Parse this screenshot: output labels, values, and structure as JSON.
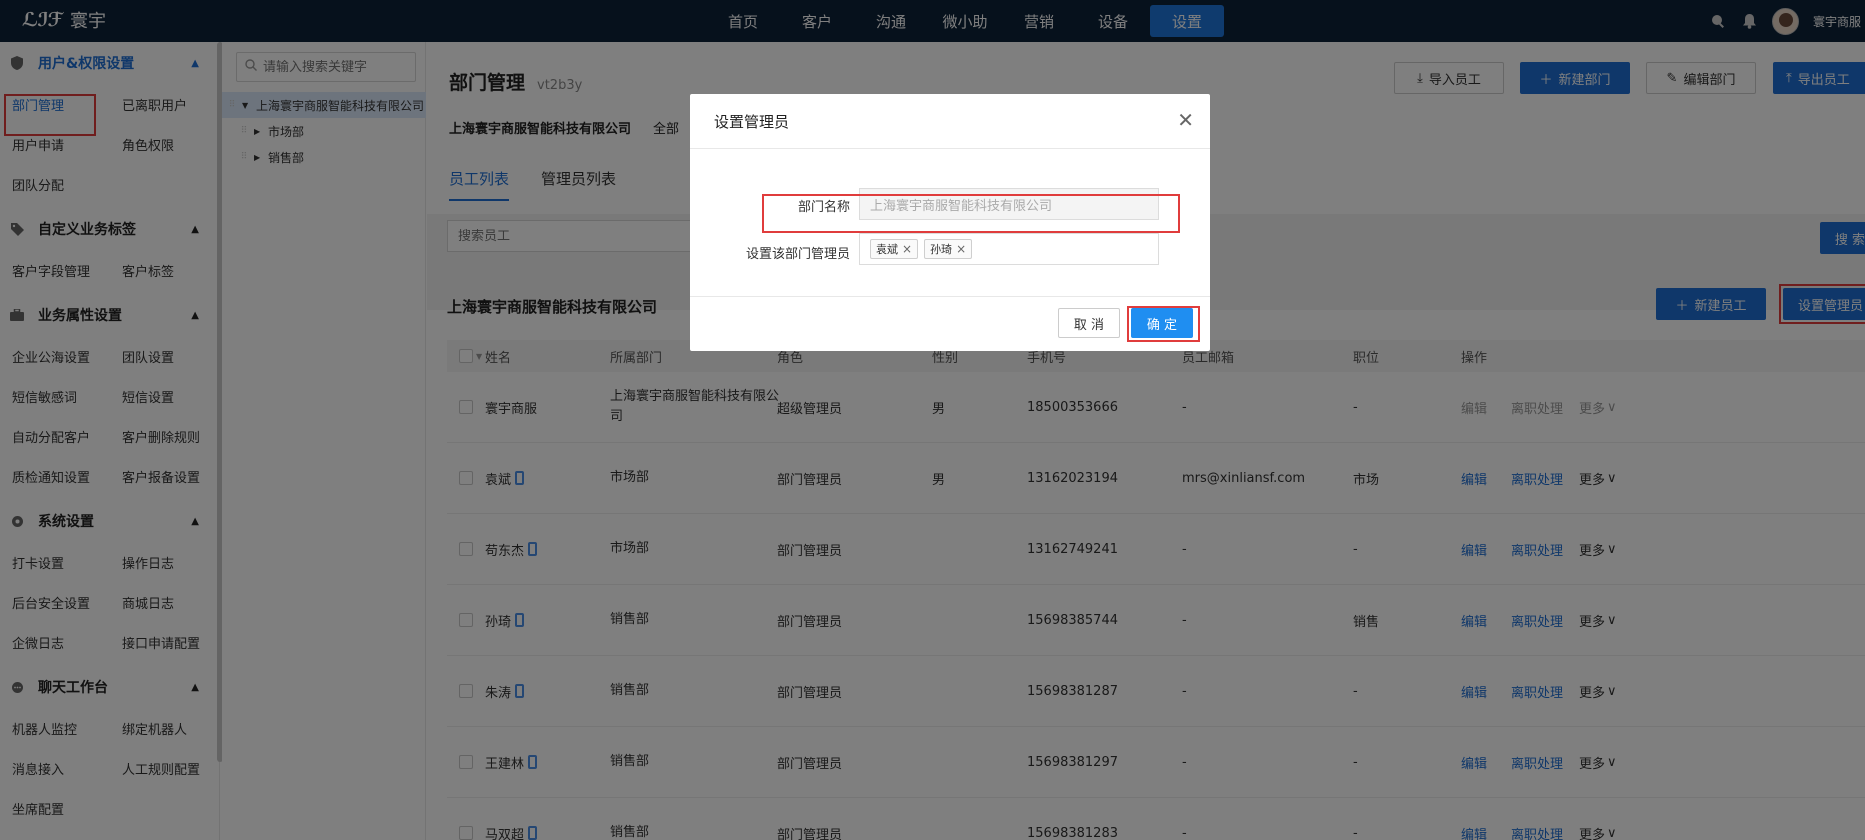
{
  "topbar": {
    "logo_mark": "ℒℐℱ",
    "logo_text": "寰宇",
    "nav": [
      "首页",
      "客户",
      "沟通",
      "微小助",
      "营销",
      "设备",
      "设置"
    ],
    "active_nav": "设置",
    "username": "寰宇商服"
  },
  "sidebar": {
    "sections": [
      {
        "title": "用户&权限设置",
        "items": [
          "部门管理",
          "已离职用户",
          "用户申请",
          "角色权限",
          "团队分配"
        ]
      },
      {
        "title": "自定义业务标签",
        "items": [
          "客户字段管理",
          "客户标签"
        ]
      },
      {
        "title": "业务属性设置",
        "items": [
          "企业公海设置",
          "团队设置",
          "短信敏感词",
          "短信设置",
          "自动分配客户",
          "客户删除规则",
          "质检通知设置",
          "客户报备设置"
        ]
      },
      {
        "title": "系统设置",
        "items": [
          "打卡设置",
          "操作日志",
          "后台安全设置",
          "商城日志",
          "企微日志",
          "接口申请配置"
        ]
      },
      {
        "title": "聊天工作台",
        "items": [
          "机器人监控",
          "绑定机器人",
          "消息接入",
          "人工规则配置",
          "坐席配置"
        ]
      }
    ]
  },
  "tree": {
    "search_placeholder": "请输入搜索关键字",
    "root": "上海寰宇商服智能科技有限公司",
    "children": [
      "市场部",
      "销售部"
    ]
  },
  "main": {
    "title": "部门管理",
    "subtitle": "vt2b3y",
    "buttons": {
      "import": "导入员工",
      "new_dept": "新建部门",
      "edit_dept": "编辑部门",
      "export": "导出员工"
    },
    "company": "上海寰宇商服智能科技有限公司",
    "company_suffix": "全部",
    "tabs": [
      "员工列表",
      "管理员列表"
    ],
    "search_placeholder": "搜索员工",
    "search_btn": "搜 索",
    "card_title": "上海寰宇商服智能科技有限公司",
    "new_employee": "新建员工",
    "set_admin": "设置管理员",
    "columns": [
      "姓名",
      "所属部门",
      "角色",
      "性别",
      "手机号",
      "员工邮箱",
      "职位",
      "操作"
    ],
    "rows": [
      {
        "name": "寰宇商服",
        "dept": "上海寰宇商服智能科技有限公司",
        "role": "超级管理员",
        "gender": "男",
        "phone": "18500353666",
        "email": "-",
        "position": "-",
        "edit": "编辑",
        "resign": "离职处理",
        "more": "更多",
        "phone_icon": false,
        "disabled": true
      },
      {
        "name": "袁斌",
        "dept": "市场部",
        "role": "部门管理员",
        "gender": "男",
        "phone": "13162023194",
        "email": "mrs@xinliansf.com",
        "position": "市场",
        "edit": "编辑",
        "resign": "离职处理",
        "more": "更多",
        "phone_icon": true,
        "disabled": false
      },
      {
        "name": "苟东杰",
        "dept": "市场部",
        "role": "部门管理员",
        "gender": "",
        "phone": "13162749241",
        "email": "-",
        "position": "-",
        "edit": "编辑",
        "resign": "离职处理",
        "more": "更多",
        "phone_icon": true,
        "disabled": false
      },
      {
        "name": "孙琦",
        "dept": "销售部",
        "role": "部门管理员",
        "gender": "",
        "phone": "15698385744",
        "email": "-",
        "position": "销售",
        "edit": "编辑",
        "resign": "离职处理",
        "more": "更多",
        "phone_icon": true,
        "disabled": false
      },
      {
        "name": "朱涛",
        "dept": "销售部",
        "role": "部门管理员",
        "gender": "",
        "phone": "15698381287",
        "email": "-",
        "position": "-",
        "edit": "编辑",
        "resign": "离职处理",
        "more": "更多",
        "phone_icon": true,
        "disabled": false
      },
      {
        "name": "王建林",
        "dept": "销售部",
        "role": "部门管理员",
        "gender": "",
        "phone": "15698381297",
        "email": "-",
        "position": "-",
        "edit": "编辑",
        "resign": "离职处理",
        "more": "更多",
        "phone_icon": true,
        "disabled": false
      },
      {
        "name": "马双超",
        "dept": "销售部",
        "role": "部门管理员",
        "gender": "",
        "phone": "15698381283",
        "email": "-",
        "position": "-",
        "edit": "编辑",
        "resign": "离职处理",
        "more": "更多",
        "phone_icon": true,
        "disabled": false
      }
    ]
  },
  "modal": {
    "title": "设置管理员",
    "dept_label": "部门名称",
    "dept_value": "上海寰宇商服智能科技有限公司",
    "admin_label": "设置该部门管理员",
    "tags": [
      "袁斌",
      "孙琦"
    ],
    "cancel": "取 消",
    "ok": "确 定"
  },
  "colors": {
    "accent": "#1f6fd4",
    "topbar": "#0c2238",
    "highlight": "#e03c3c"
  }
}
